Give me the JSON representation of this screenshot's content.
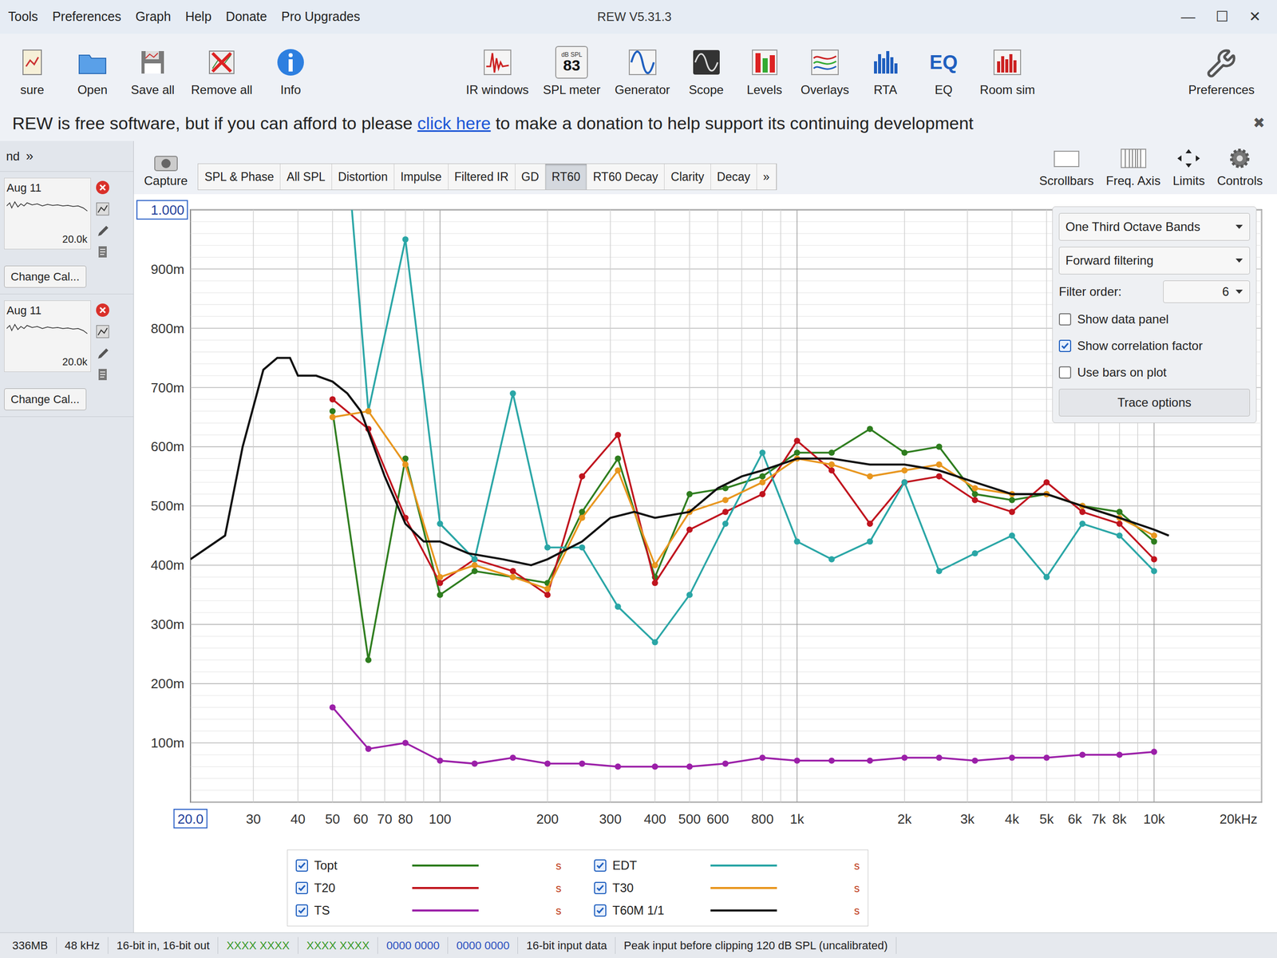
{
  "window": {
    "title": "REW V5.31.3",
    "controls": [
      "—",
      "☐",
      "✕"
    ]
  },
  "menu": [
    "Tools",
    "Preferences",
    "Graph",
    "Help",
    "Donate",
    "Pro Upgrades"
  ],
  "toolbar": {
    "left": [
      {
        "label": "sure",
        "kind": "measure"
      },
      {
        "label": "Open",
        "kind": "open"
      },
      {
        "label": "Save all",
        "kind": "save"
      },
      {
        "label": "Remove all",
        "kind": "remove"
      },
      {
        "label": "Info",
        "kind": "info"
      }
    ],
    "center": [
      {
        "label": "IR windows",
        "kind": "ir"
      },
      {
        "label": "SPL meter",
        "kind": "spl",
        "icon_text": [
          "dB SPL",
          "83"
        ]
      },
      {
        "label": "Generator",
        "kind": "generator"
      },
      {
        "label": "Scope",
        "kind": "scope"
      },
      {
        "label": "Levels",
        "kind": "levels"
      },
      {
        "label": "Overlays",
        "kind": "overlays"
      },
      {
        "label": "RTA",
        "kind": "rta"
      },
      {
        "label": "EQ",
        "kind": "eq",
        "icon_text": [
          "EQ"
        ]
      },
      {
        "label": "Room sim",
        "kind": "roomsim"
      }
    ],
    "right": [
      {
        "label": "Preferences",
        "kind": "wrench"
      }
    ]
  },
  "banner": {
    "before": "REW is free software, but if you can afford to please ",
    "link": "click here",
    "after": " to make a donation to help support its continuing development",
    "close": "✖"
  },
  "sidebar": {
    "header": {
      "label": "nd",
      "more": "»"
    },
    "measurements": [
      {
        "date": "Aug 11",
        "freq_end": "20.0k",
        "change_cal": "Change Cal..."
      },
      {
        "date": "Aug 11",
        "freq_end": "20.0k",
        "change_cal": "Change Cal..."
      }
    ]
  },
  "capture": "Capture",
  "tabs": [
    {
      "label": "SPL & Phase",
      "selected": false
    },
    {
      "label": "All SPL",
      "selected": false
    },
    {
      "label": "Distortion",
      "selected": false
    },
    {
      "label": "Impulse",
      "selected": false
    },
    {
      "label": "Filtered IR",
      "selected": false
    },
    {
      "label": "GD",
      "selected": false
    },
    {
      "label": "RT60",
      "selected": true
    },
    {
      "label": "RT60 Decay",
      "selected": false
    },
    {
      "label": "Clarity",
      "selected": false
    },
    {
      "label": "Decay",
      "selected": false
    },
    {
      "label": "»",
      "selected": false
    }
  ],
  "view_controls": [
    {
      "label": "Scrollbars",
      "kind": "scrollbars"
    },
    {
      "label": "Freq. Axis",
      "kind": "freqaxis"
    },
    {
      "label": "Limits",
      "kind": "limits"
    },
    {
      "label": "Controls",
      "kind": "gear"
    }
  ],
  "controls_panel": {
    "band_select": "One Third Octave Bands",
    "filtering": "Forward filtering",
    "filter_order_label": "Filter order:",
    "filter_order": "6",
    "checkboxes": [
      {
        "label": "Show data panel",
        "checked": false
      },
      {
        "label": "Show correlation factor",
        "checked": true
      },
      {
        "label": "Use bars on plot",
        "checked": false
      }
    ],
    "button": "Trace options"
  },
  "chart": {
    "y_ticks": [
      {
        "label": "1.000",
        "value": 1.0,
        "boxed": true
      },
      {
        "label": "900m",
        "value": 0.9,
        "boxed": false
      },
      {
        "label": "800m",
        "value": 0.8,
        "boxed": false
      },
      {
        "label": "700m",
        "value": 0.7,
        "boxed": false
      },
      {
        "label": "600m",
        "value": 0.6,
        "boxed": false
      },
      {
        "label": "500m",
        "value": 0.5,
        "boxed": false
      },
      {
        "label": "400m",
        "value": 0.4,
        "boxed": false
      },
      {
        "label": "300m",
        "value": 0.3,
        "boxed": false
      },
      {
        "label": "200m",
        "value": 0.2,
        "boxed": false
      },
      {
        "label": "100m",
        "value": 0.1,
        "boxed": false
      }
    ],
    "x_ticks": [
      {
        "label": "20.0",
        "value": 20,
        "boxed": true
      },
      {
        "label": "30",
        "value": 30,
        "boxed": false
      },
      {
        "label": "40",
        "value": 40,
        "boxed": false
      },
      {
        "label": "50",
        "value": 50,
        "boxed": false
      },
      {
        "label": "60",
        "value": 60,
        "boxed": false
      },
      {
        "label": "70",
        "value": 70,
        "boxed": false
      },
      {
        "label": "80",
        "value": 80,
        "boxed": false
      },
      {
        "label": "100",
        "value": 100,
        "boxed": false
      },
      {
        "label": "200",
        "value": 200,
        "boxed": false
      },
      {
        "label": "300",
        "value": 300,
        "boxed": false
      },
      {
        "label": "400",
        "value": 400,
        "boxed": false
      },
      {
        "label": "500",
        "value": 500,
        "boxed": false
      },
      {
        "label": "600",
        "value": 600,
        "boxed": false
      },
      {
        "label": "800",
        "value": 800,
        "boxed": false
      },
      {
        "label": "1k",
        "value": 1000,
        "boxed": false
      },
      {
        "label": "2k",
        "value": 2000,
        "boxed": false
      },
      {
        "label": "3k",
        "value": 3000,
        "boxed": false
      },
      {
        "label": "4k",
        "value": 4000,
        "boxed": false
      },
      {
        "label": "5k",
        "value": 5000,
        "boxed": false
      },
      {
        "label": "6k",
        "value": 6000,
        "boxed": false
      },
      {
        "label": "7k",
        "value": 7000,
        "boxed": false
      },
      {
        "label": "8k",
        "value": 8000,
        "boxed": false
      },
      {
        "label": "10k",
        "value": 10000,
        "boxed": false
      },
      {
        "label": "20kHz",
        "value": 20000,
        "boxed": false
      }
    ],
    "bands": [
      50,
      63,
      80,
      100,
      125,
      160,
      200,
      250,
      315,
      400,
      500,
      630,
      800,
      1000,
      1250,
      1600,
      2000,
      2500,
      3150,
      4000,
      5000,
      6300,
      8000,
      10000
    ],
    "series": [
      {
        "name": "Topt",
        "checked": true,
        "color": "#2e7d1e",
        "unit": "s",
        "kind": "points",
        "values": [
          0.66,
          0.24,
          0.58,
          0.35,
          0.39,
          0.38,
          0.37,
          0.49,
          0.58,
          0.38,
          0.52,
          0.53,
          0.55,
          0.59,
          0.59,
          0.63,
          0.59,
          0.6,
          0.52,
          0.51,
          0.52,
          0.5,
          0.49,
          0.44
        ]
      },
      {
        "name": "T20",
        "checked": true,
        "color": "#c0141e",
        "unit": "s",
        "kind": "points",
        "values": [
          0.68,
          0.63,
          0.48,
          0.37,
          0.41,
          0.39,
          0.35,
          0.55,
          0.62,
          0.37,
          0.46,
          0.49,
          0.52,
          0.61,
          0.56,
          0.47,
          0.54,
          0.55,
          0.51,
          0.49,
          0.54,
          0.49,
          0.47,
          0.41
        ]
      },
      {
        "name": "TS",
        "checked": true,
        "color": "#9b1fa8",
        "unit": "s",
        "kind": "points",
        "values": [
          0.16,
          0.09,
          0.1,
          0.07,
          0.065,
          0.075,
          0.065,
          0.065,
          0.06,
          0.06,
          0.06,
          0.065,
          0.075,
          0.07,
          0.07,
          0.07,
          0.075,
          0.075,
          0.07,
          0.075,
          0.075,
          0.08,
          0.08,
          0.085
        ]
      },
      {
        "name": "EDT",
        "checked": true,
        "color": "#2aa6a6",
        "unit": "s",
        "kind": "points",
        "values": [
          1.4,
          0.66,
          0.95,
          0.47,
          0.41,
          0.69,
          0.43,
          0.43,
          0.33,
          0.27,
          0.35,
          0.47,
          0.59,
          0.44,
          0.41,
          0.44,
          0.54,
          0.39,
          0.42,
          0.45,
          0.38,
          0.47,
          0.45,
          0.39
        ]
      },
      {
        "name": "T30",
        "checked": true,
        "color": "#e8961e",
        "unit": "s",
        "kind": "points",
        "values": [
          0.65,
          0.66,
          0.57,
          0.38,
          0.4,
          0.38,
          0.36,
          0.48,
          0.56,
          0.4,
          0.49,
          0.51,
          0.54,
          0.58,
          0.57,
          0.55,
          0.56,
          0.57,
          0.53,
          0.52,
          0.52,
          0.5,
          0.48,
          0.45
        ]
      },
      {
        "name": "T60M 1/1",
        "checked": true,
        "color": "#111111",
        "unit": "s",
        "kind": "line",
        "x": [
          20,
          25,
          28,
          32,
          35,
          38,
          40,
          45,
          50,
          55,
          60,
          70,
          80,
          90,
          100,
          120,
          150,
          180,
          200,
          250,
          300,
          350,
          400,
          500,
          600,
          700,
          800,
          1000,
          1250,
          1600,
          2000,
          2500,
          3150,
          4000,
          5000,
          6300,
          8000,
          10000,
          11000
        ],
        "values": [
          0.41,
          0.45,
          0.6,
          0.73,
          0.75,
          0.75,
          0.72,
          0.72,
          0.71,
          0.69,
          0.66,
          0.55,
          0.47,
          0.44,
          0.44,
          0.42,
          0.41,
          0.4,
          0.41,
          0.44,
          0.48,
          0.49,
          0.48,
          0.49,
          0.53,
          0.55,
          0.56,
          0.58,
          0.58,
          0.57,
          0.57,
          0.56,
          0.54,
          0.52,
          0.52,
          0.5,
          0.48,
          0.46,
          0.45
        ]
      }
    ]
  },
  "status_bar": [
    "336MB",
    "48 kHz",
    "16-bit in, 16-bit out",
    "XXXX XXXX",
    "XXXX XXXX",
    "0000 0000",
    "0000 0000",
    "16-bit input data",
    "Peak input before clipping 120 dB SPL (uncalibrated)"
  ]
}
